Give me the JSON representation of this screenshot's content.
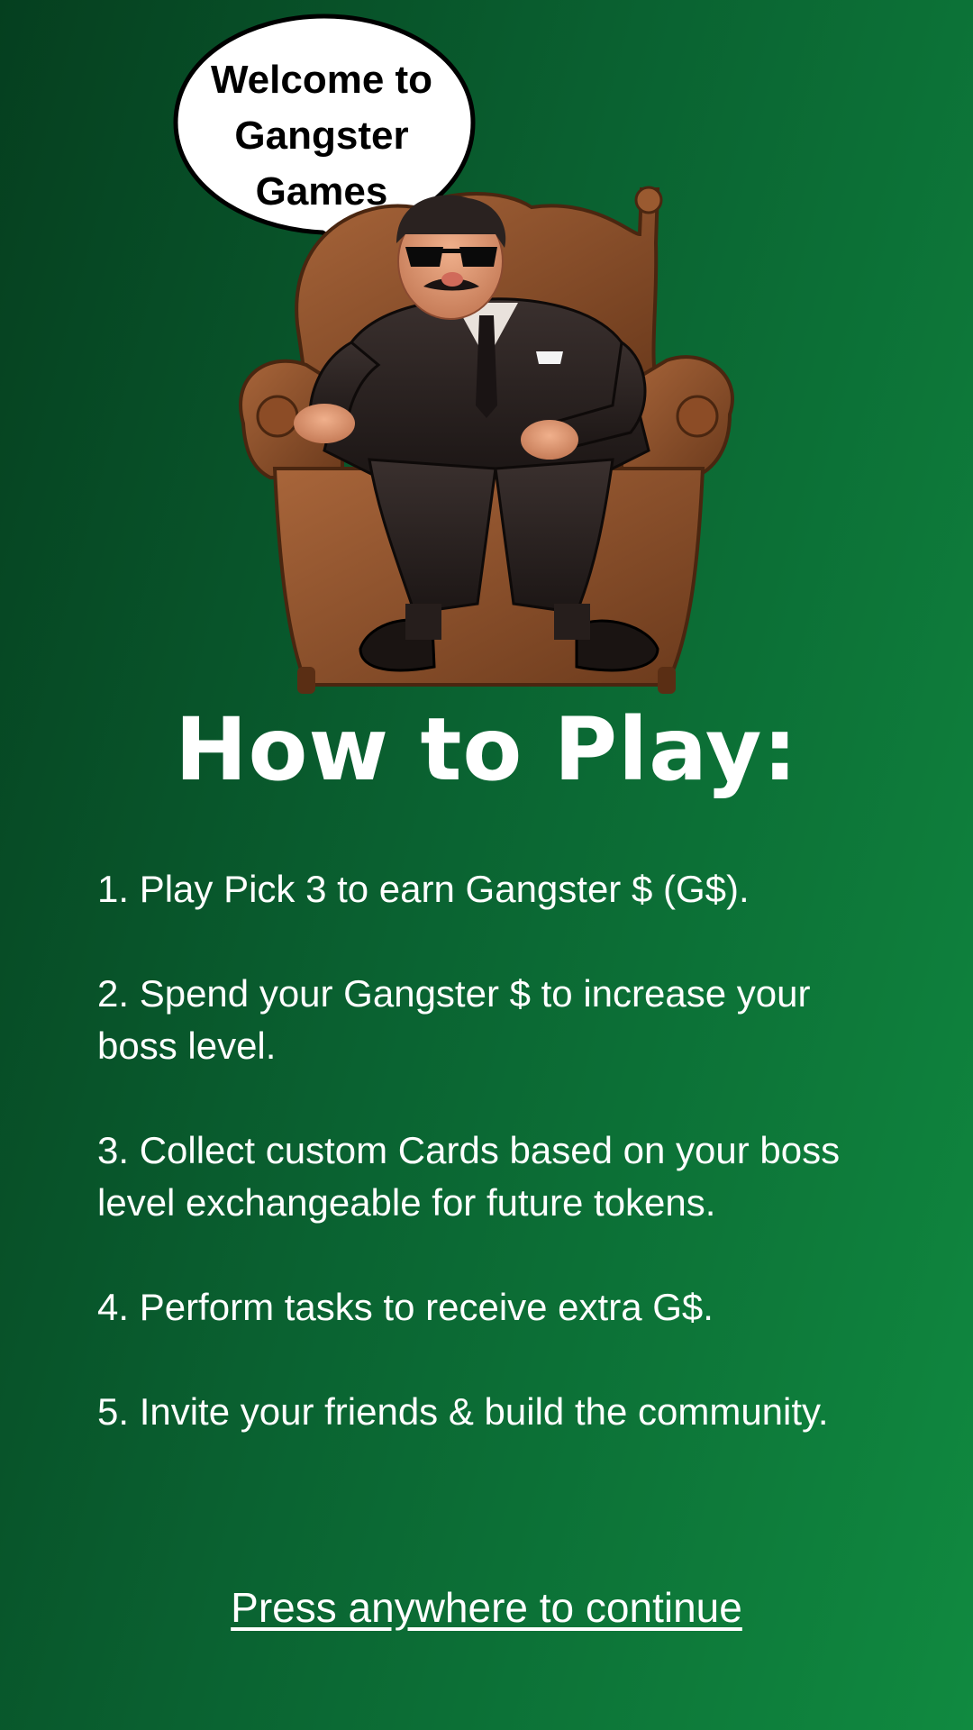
{
  "speech_bubble": {
    "lines": [
      "Welcome to",
      "Gangster",
      "Games"
    ]
  },
  "title": "How to Play:",
  "rules": [
    "1. Play Pick 3 to earn Gangster $ (G$).",
    "2. Spend your Gangster $ to increase your boss level.",
    "3. Collect custom Cards based on your boss level exchangeable for future tokens.",
    "4. Perform tasks to receive extra G$.",
    "5. Invite your friends & build the community."
  ],
  "continue_label": "Press anywhere to continue",
  "colors": {
    "background_start": "#053f1f",
    "background_end": "#108a40",
    "text": "#ffffff",
    "bubble_fill": "#ffffff",
    "bubble_stroke": "#000000"
  }
}
